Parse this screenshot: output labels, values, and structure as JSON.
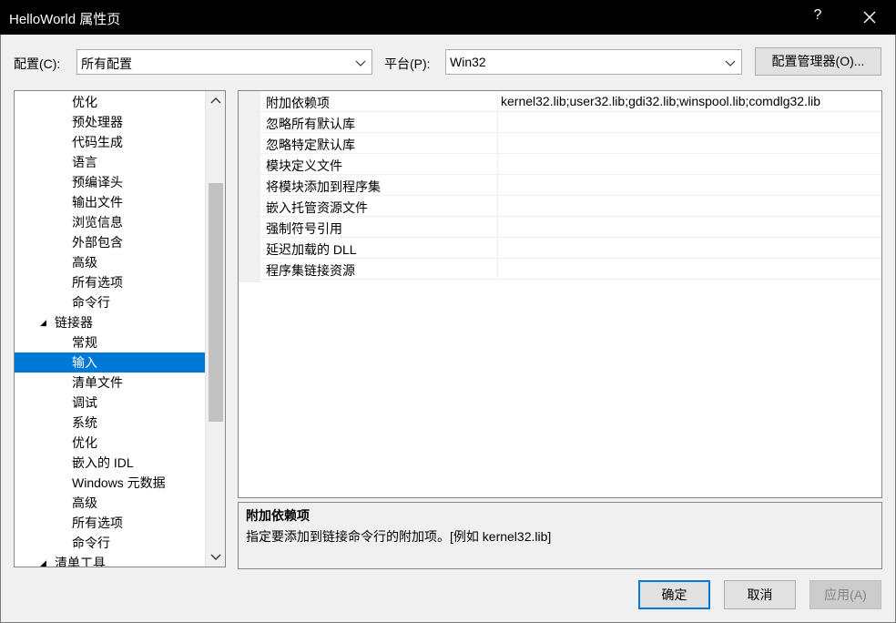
{
  "window": {
    "title": "HelloWorld 属性页",
    "help_label": "?"
  },
  "toolbar": {
    "config_label": "配置(C):",
    "config_value": "所有配置",
    "platform_label": "平台(P):",
    "platform_value": "Win32",
    "config_manager_label": "配置管理器(O)..."
  },
  "tree": {
    "items": [
      {
        "label": "优化",
        "level": 2
      },
      {
        "label": "预处理器",
        "level": 2
      },
      {
        "label": "代码生成",
        "level": 2
      },
      {
        "label": "语言",
        "level": 2
      },
      {
        "label": "预编译头",
        "level": 2
      },
      {
        "label": "输出文件",
        "level": 2
      },
      {
        "label": "浏览信息",
        "level": 2
      },
      {
        "label": "外部包含",
        "level": 2
      },
      {
        "label": "高级",
        "level": 2
      },
      {
        "label": "所有选项",
        "level": 2
      },
      {
        "label": "命令行",
        "level": 2
      },
      {
        "label": "链接器",
        "level": 1,
        "expanded": true
      },
      {
        "label": "常规",
        "level": 2
      },
      {
        "label": "输入",
        "level": 2,
        "selected": true
      },
      {
        "label": "清单文件",
        "level": 2
      },
      {
        "label": "调试",
        "level": 2
      },
      {
        "label": "系统",
        "level": 2
      },
      {
        "label": "优化",
        "level": 2
      },
      {
        "label": "嵌入的 IDL",
        "level": 2
      },
      {
        "label": "Windows 元数据",
        "level": 2
      },
      {
        "label": "高级",
        "level": 2
      },
      {
        "label": "所有选项",
        "level": 2
      },
      {
        "label": "命令行",
        "level": 2
      },
      {
        "label": "清单工具",
        "level": 1,
        "expanded": true
      }
    ]
  },
  "properties": {
    "rows": [
      {
        "name": "附加依赖项",
        "value": "kernel32.lib;user32.lib;gdi32.lib;winspool.lib;comdlg32.lib"
      },
      {
        "name": "忽略所有默认库",
        "value": ""
      },
      {
        "name": "忽略特定默认库",
        "value": ""
      },
      {
        "name": "模块定义文件",
        "value": ""
      },
      {
        "name": "将模块添加到程序集",
        "value": ""
      },
      {
        "name": "嵌入托管资源文件",
        "value": ""
      },
      {
        "name": "强制符号引用",
        "value": ""
      },
      {
        "name": "延迟加载的 DLL",
        "value": ""
      },
      {
        "name": "程序集链接资源",
        "value": ""
      }
    ]
  },
  "description": {
    "title": "附加依赖项",
    "text": "指定要添加到链接命令行的附加项。[例如 kernel32.lib]"
  },
  "buttons": {
    "ok": "确定",
    "cancel": "取消",
    "apply": "应用(A)"
  },
  "colors": {
    "selection": "#0078d7",
    "titlebar": "#000000"
  }
}
